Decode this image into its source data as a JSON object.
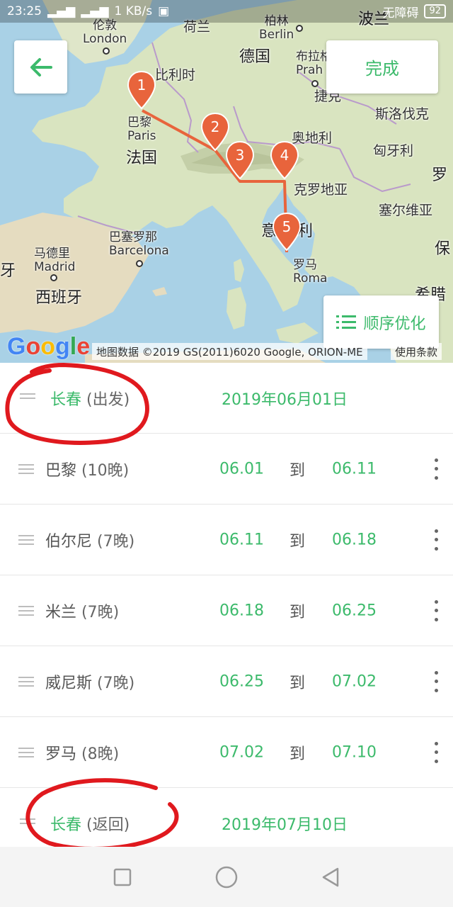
{
  "status_bar": {
    "time": "23:25",
    "network": "1 KB/s",
    "carrier": "无障碍",
    "battery": "92"
  },
  "map": {
    "labels": {
      "london": "伦敦",
      "london_en": "London",
      "netherlands": "荷兰",
      "berlin": "柏林",
      "berlin_en": "Berlin",
      "poland": "波兰",
      "germany": "德国",
      "prague": "布拉格",
      "prague_en": "Prah",
      "czech": "捷克",
      "belgium": "比利时",
      "paris": "巴黎",
      "paris_en": "Paris",
      "slovakia": "斯洛伐克",
      "france": "法国",
      "austria": "奥地利",
      "hungary": "匈牙利",
      "romania_partial": "罗",
      "croatia": "克罗地亚",
      "serbia": "塞尔维亚",
      "barcelona": "巴塞罗那",
      "barcelona_en": "Barcelona",
      "italy_1": "意",
      "italy_2": "利",
      "bulgaria_partial": "保",
      "madrid": "马德里",
      "madrid_en": "Madrid",
      "rome": "罗马",
      "rome_en": "Roma",
      "spain": "西班牙",
      "greece_partial": "希腊",
      "portugal_partial": "牙"
    },
    "markers": [
      "1",
      "2",
      "3",
      "4",
      "5"
    ],
    "done_label": "完成",
    "optimize_label": "顺序优化",
    "google_logo": "Google",
    "credits": "地图数据 ©2019 GS(2011)6020 Google, ORION-ME",
    "terms": "使用条款",
    "route_color": "#e8643c",
    "accent": "#3cba6b"
  },
  "stops": {
    "departure": {
      "city": "长春",
      "note": "(出发)",
      "date": "2019年06月01日"
    },
    "items": [
      {
        "city": "巴黎",
        "nights": "(10晚)",
        "from": "06.01",
        "to_word": "到",
        "to": "06.11"
      },
      {
        "city": "伯尔尼",
        "nights": "(7晚)",
        "from": "06.11",
        "to_word": "到",
        "to": "06.18"
      },
      {
        "city": "米兰",
        "nights": "(7晚)",
        "from": "06.18",
        "to_word": "到",
        "to": "06.25"
      },
      {
        "city": "威尼斯",
        "nights": "(7晚)",
        "from": "06.25",
        "to_word": "到",
        "to": "07.02"
      },
      {
        "city": "罗马",
        "nights": "(8晚)",
        "from": "07.02",
        "to_word": "到",
        "to": "07.10"
      }
    ],
    "return": {
      "city": "长春",
      "note": "(返回)",
      "date": "2019年07月10日"
    }
  }
}
